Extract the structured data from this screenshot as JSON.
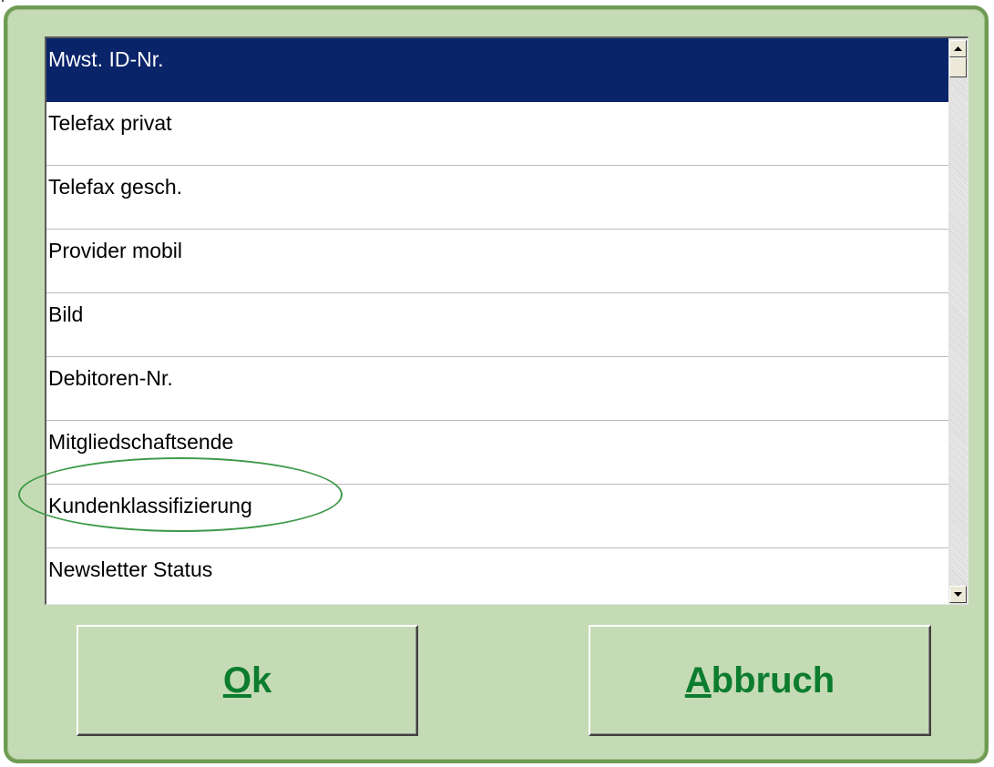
{
  "list": {
    "items": [
      {
        "label": "Mwst. ID-Nr.",
        "selected": true
      },
      {
        "label": "Telefax privat",
        "selected": false
      },
      {
        "label": "Telefax gesch.",
        "selected": false
      },
      {
        "label": "Provider mobil",
        "selected": false
      },
      {
        "label": "Bild",
        "selected": false
      },
      {
        "label": "Debitoren-Nr.",
        "selected": false
      },
      {
        "label": "Mitgliedschaftsende",
        "selected": false
      },
      {
        "label": "Kundenklassifizierung",
        "selected": false
      },
      {
        "label": "Newsletter Status",
        "selected": false
      }
    ],
    "selected_color": "#0a246a",
    "highlighted_item": "Kundenklassifizierung"
  },
  "scrollbar": {
    "up_icon": "arrow-up-icon",
    "down_icon": "arrow-down-icon"
  },
  "buttons": {
    "ok": {
      "mnemonic": "O",
      "rest": "k"
    },
    "cancel": {
      "mnemonic": "A",
      "rest": "bbruch"
    }
  },
  "colors": {
    "dialog_background": "#c5dbb5",
    "dialog_border": "#6f9b52",
    "button_text": "#0c7c2e",
    "annotation_ellipse": "#3f9a4a"
  }
}
